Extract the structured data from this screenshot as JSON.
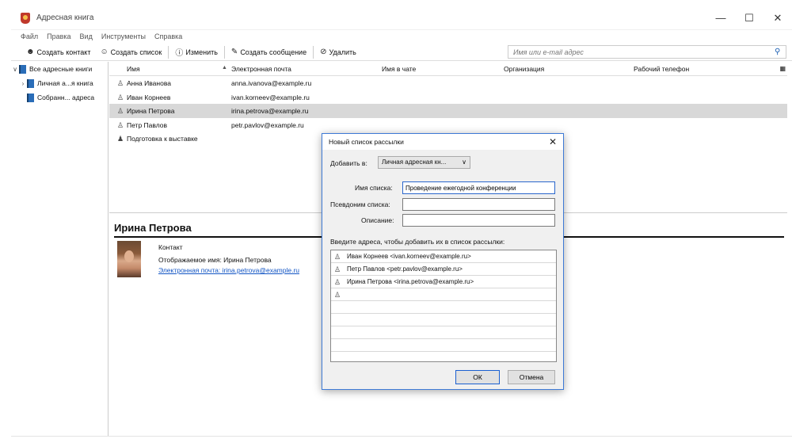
{
  "window": {
    "title": "Адресная книга",
    "controls": {
      "minimize": "—",
      "maximize": "☐",
      "close": "✕"
    }
  },
  "menu": [
    "Файл",
    "Правка",
    "Вид",
    "Инструменты",
    "Справка"
  ],
  "toolbar": {
    "new_contact": "Создать контакт",
    "new_list": "Создать список",
    "edit": "Изменить",
    "new_message": "Создать сообщение",
    "delete": "Удалить",
    "search_placeholder": "Имя или e-mail адрес"
  },
  "sidebar": {
    "root": "Все адресные книги",
    "items": [
      "Личная а...я книга",
      "Собранн... адреса"
    ]
  },
  "columns": [
    "Имя",
    "Электронная почта",
    "Имя в чате",
    "Организация",
    "Рабочий телефон"
  ],
  "contacts": [
    {
      "name": "Анна Иванова",
      "email": "anna.ivanova@example.ru",
      "kind": "contact"
    },
    {
      "name": "Иван Корнеев",
      "email": "ivan.korneev@example.ru",
      "kind": "contact"
    },
    {
      "name": "Ирина Петрова",
      "email": "irina.petrova@example.ru",
      "kind": "contact",
      "selected": true
    },
    {
      "name": "Петр Павлов",
      "email": "petr.pavlov@example.ru",
      "kind": "contact"
    },
    {
      "name": "Подготовка к выставке",
      "email": "",
      "kind": "list"
    }
  ],
  "card": {
    "name": "Ирина Петрова",
    "kind": "Контакт",
    "display_name": "Отображаемое имя: Ирина Петрова",
    "email": "Электронная почта: irina.petrova@example.ru"
  },
  "dialog": {
    "title": "Новый список рассылки",
    "add_to_label": "Добавить в:",
    "add_to_value": "Личная адресная кн...",
    "list_name_label": "Имя списка:",
    "list_name_value": "Проведение ежегодной конференции",
    "nickname_label": "Псевдоним списка:",
    "nickname_value": "",
    "description_label": "Описание:",
    "description_value": "",
    "addresses_label": "Введите адреса, чтобы добавить их в список рассылки:",
    "addresses": [
      "Иван Корнеев <ivan.korneev@example.ru>",
      "Петр Павлов <petr.pavlov@example.ru>",
      "Ирина Петрова <irina.petrova@example.ru>",
      "",
      "",
      "",
      "",
      "",
      ""
    ],
    "ok": "ОК",
    "cancel": "Отмена"
  }
}
